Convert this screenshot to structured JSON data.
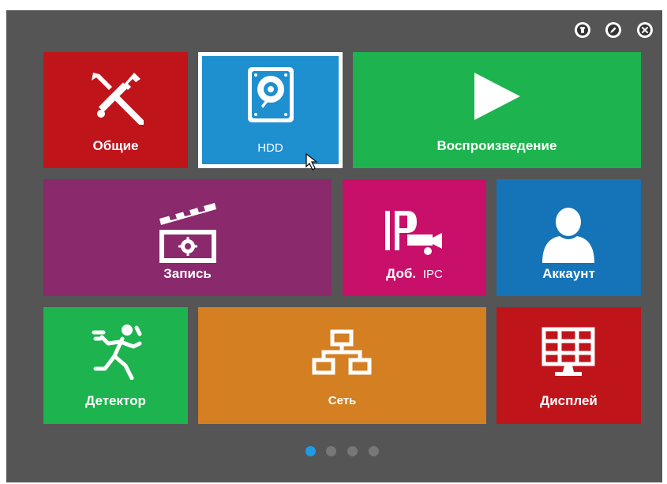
{
  "window_controls": {
    "skin_icon": "t-shirt-icon",
    "edit_icon": "pencil-icon",
    "close_icon": "close-icon"
  },
  "tiles": {
    "general": {
      "label": "Общие",
      "color": "#c0141b",
      "icon": "tools-icon"
    },
    "hdd": {
      "label": "HDD",
      "color": "#1e8fcf",
      "icon": "hdd-icon",
      "selected": true
    },
    "playback": {
      "label": "Воспроизведение",
      "color": "#1db34e",
      "icon": "play-icon"
    },
    "record": {
      "label": "Запись",
      "color": "#8a2a6c",
      "icon": "clapperboard-icon"
    },
    "add_ipc": {
      "label_main": "Доб.",
      "label_suffix": "IPC",
      "color": "#c8106b",
      "icon": "ip-camera-icon"
    },
    "account": {
      "label": "Аккаунт",
      "color": "#1573b8",
      "icon": "user-icon"
    },
    "detector": {
      "label": "Детектор",
      "color": "#1db34e",
      "icon": "running-man-icon"
    },
    "network": {
      "label": "Сеть",
      "color": "#d47f22",
      "icon": "network-icon"
    },
    "display": {
      "label": "Дисплей",
      "color": "#c0141b",
      "icon": "monitor-grid-icon"
    }
  },
  "pagination": {
    "pages": 4,
    "active": 1,
    "active_color": "#1e9be5",
    "inactive_color": "#777777"
  }
}
